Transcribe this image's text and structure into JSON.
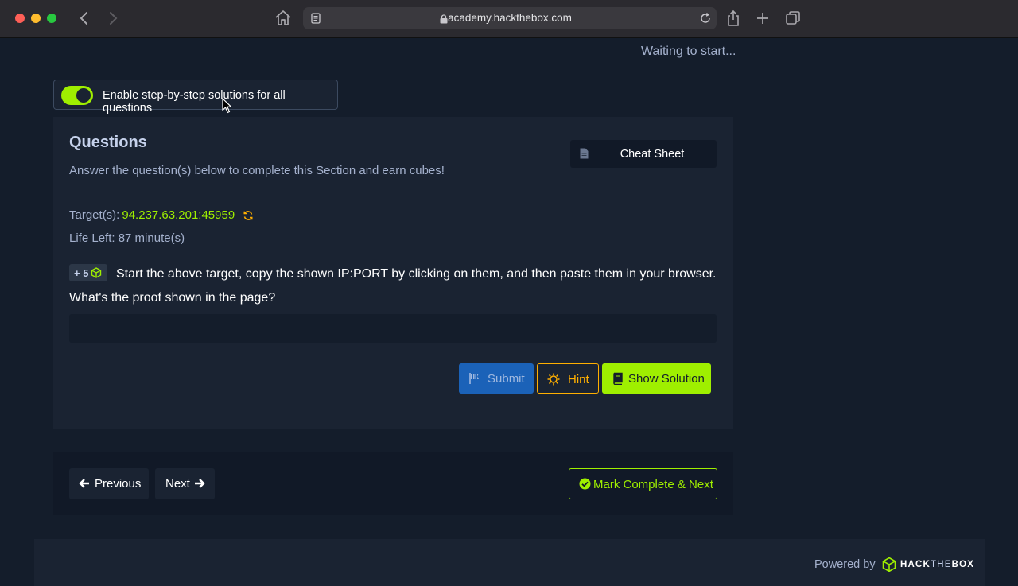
{
  "browser": {
    "url": "academy.hackthebox.com"
  },
  "page": {
    "status_text": "Waiting to start...",
    "toggle": {
      "label": "Enable step-by-step solutions for all questions",
      "on": true
    },
    "questions": {
      "title": "Questions",
      "subtitle": "Answer the question(s) below to complete this Section and earn cubes!",
      "cheat_sheet_label": "Cheat Sheet",
      "target_label": "Target(s):",
      "target_value": "94.237.63.201:45959",
      "life_left": "Life Left: 87 minute(s)",
      "badge": "+ 5",
      "question_text": "Start the above target, copy the shown IP:PORT by clicking on them, and then paste them in your browser. What's the proof shown in the page?",
      "answer_value": "",
      "buttons": {
        "submit": "Submit",
        "hint": "Hint",
        "solution": "Show Solution"
      }
    },
    "navigation": {
      "previous": "Previous",
      "next": "Next",
      "complete": "Mark Complete & Next"
    },
    "footer": {
      "powered_by": "Powered by",
      "brand_bold": "HACK",
      "brand_thin": "THE",
      "brand_bold2": "BOX"
    }
  },
  "colors": {
    "background": "#141d2b",
    "panel": "#1a2332",
    "accent_green": "#9fef00",
    "hint_orange": "#ffaf00",
    "submit_blue": "#1b62b8"
  },
  "icons": [
    "chevron-left-icon",
    "chevron-right-icon",
    "home-icon",
    "reader-icon",
    "lock-icon",
    "reload-icon",
    "share-icon",
    "plus-icon",
    "tabs-icon",
    "document-icon",
    "refresh-icon",
    "cube-icon",
    "flag-icon",
    "hint-icon",
    "book-icon",
    "arrow-left-icon",
    "arrow-right-icon",
    "check-circle-icon",
    "htb-logo-icon"
  ]
}
